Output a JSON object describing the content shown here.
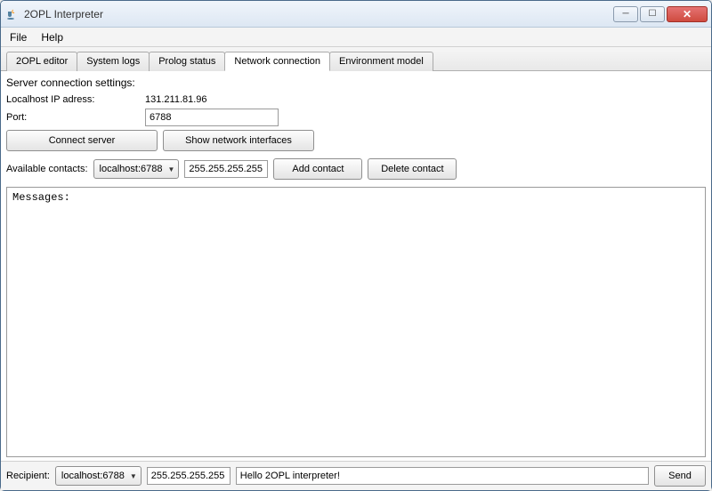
{
  "window": {
    "title": "2OPL Interpreter"
  },
  "menu": {
    "file": "File",
    "help": "Help"
  },
  "tabs": [
    {
      "label": "2OPL editor"
    },
    {
      "label": "System logs"
    },
    {
      "label": "Prolog status"
    },
    {
      "label": "Network connection"
    },
    {
      "label": "Environment model"
    }
  ],
  "network": {
    "section_title": "Server connection settings:",
    "ip_label": "Localhost IP adress:",
    "ip_value": "131.211.81.96",
    "port_label": "Port:",
    "port_value": "6788",
    "connect_btn": "Connect server",
    "show_if_btn": "Show network interfaces",
    "available_label": "Available contacts:",
    "contact_selected": "localhost:6788",
    "contact_mask": "255.255.255.255",
    "add_contact_btn": "Add contact",
    "delete_contact_btn": "Delete contact",
    "messages_header": "Messages:"
  },
  "footer": {
    "recipient_label": "Recipient:",
    "recipient_selected": "localhost:6788",
    "recipient_mask": "255.255.255.255",
    "message_value": "Hello 2OPL interpreter!",
    "send_btn": "Send"
  }
}
